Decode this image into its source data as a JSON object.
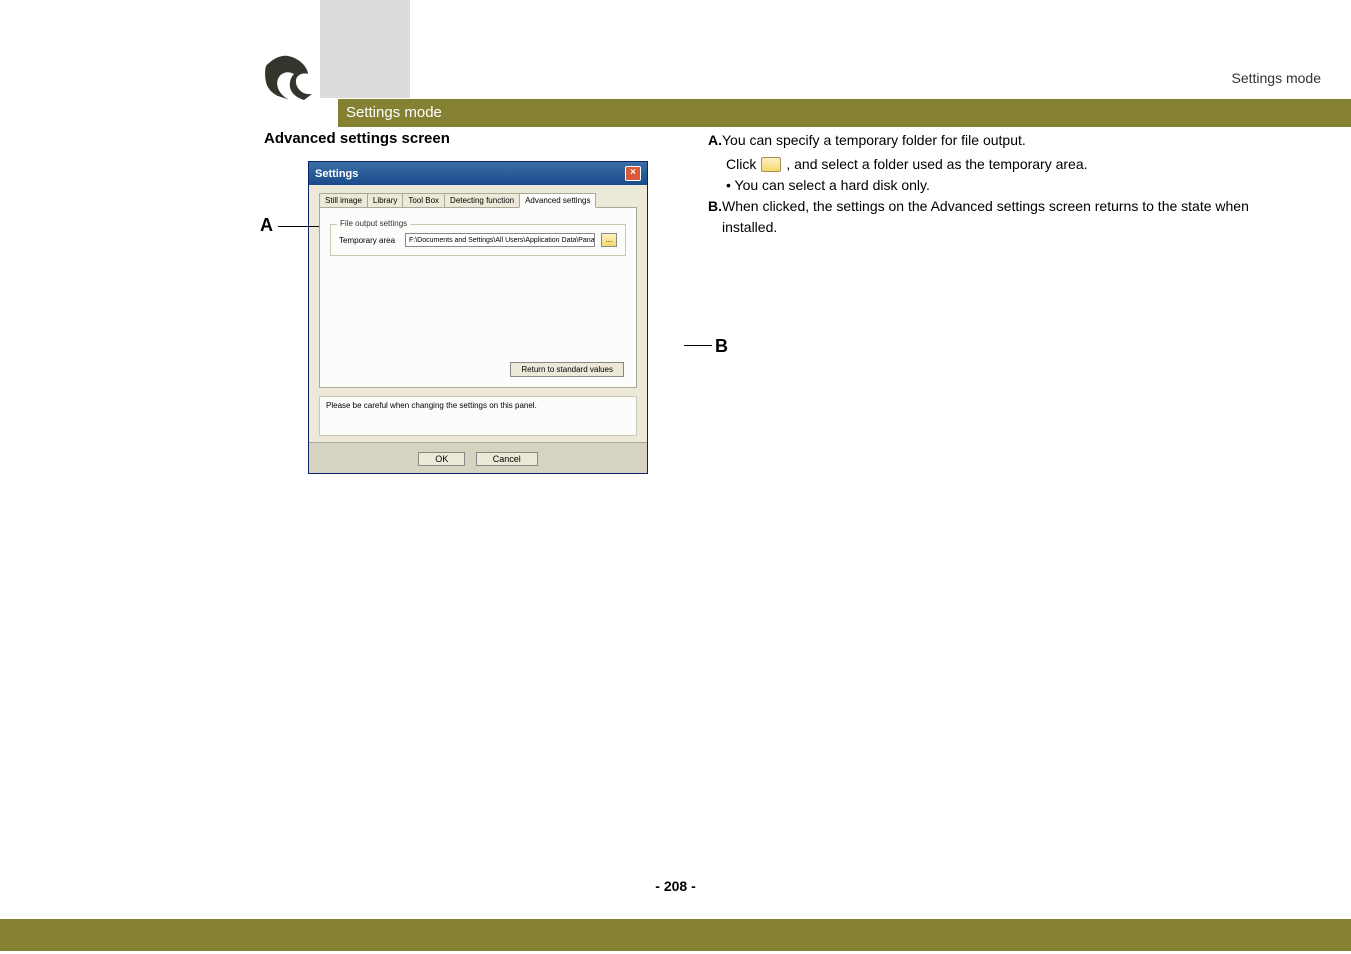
{
  "header": {
    "top_right": "Settings mode",
    "bar_title": "Settings mode"
  },
  "left": {
    "heading": "Advanced settings screen",
    "label_a": "A",
    "label_b": "B",
    "dialog": {
      "title": "Settings",
      "close": "×",
      "tabs": {
        "still": "Still image",
        "library": "Library",
        "toolbox": "Tool Box",
        "detecting": "Detecting function",
        "advanced": "Advanced settings"
      },
      "fieldset_legend": "File output settings",
      "field_label": "Temporary area",
      "path_value": "F:\\Documents and Settings\\All Users\\Application Data\\Panas",
      "browse": "...",
      "return_btn": "Return to standard values",
      "caution": "Please be careful when changing the settings on this panel.",
      "ok": "OK",
      "cancel": "Cancel"
    }
  },
  "right": {
    "a_letter": "A.",
    "a_text": "You can specify a temporary folder for file output.",
    "a_click_pre": "Click ",
    "a_click_post": ", and select a folder used as the temporary area.",
    "a_bullet": "• You can select a hard disk only.",
    "b_letter": "B.",
    "b_text": "When clicked, the settings on the Advanced settings screen returns to the state when installed."
  },
  "page_number": "- 208 -"
}
